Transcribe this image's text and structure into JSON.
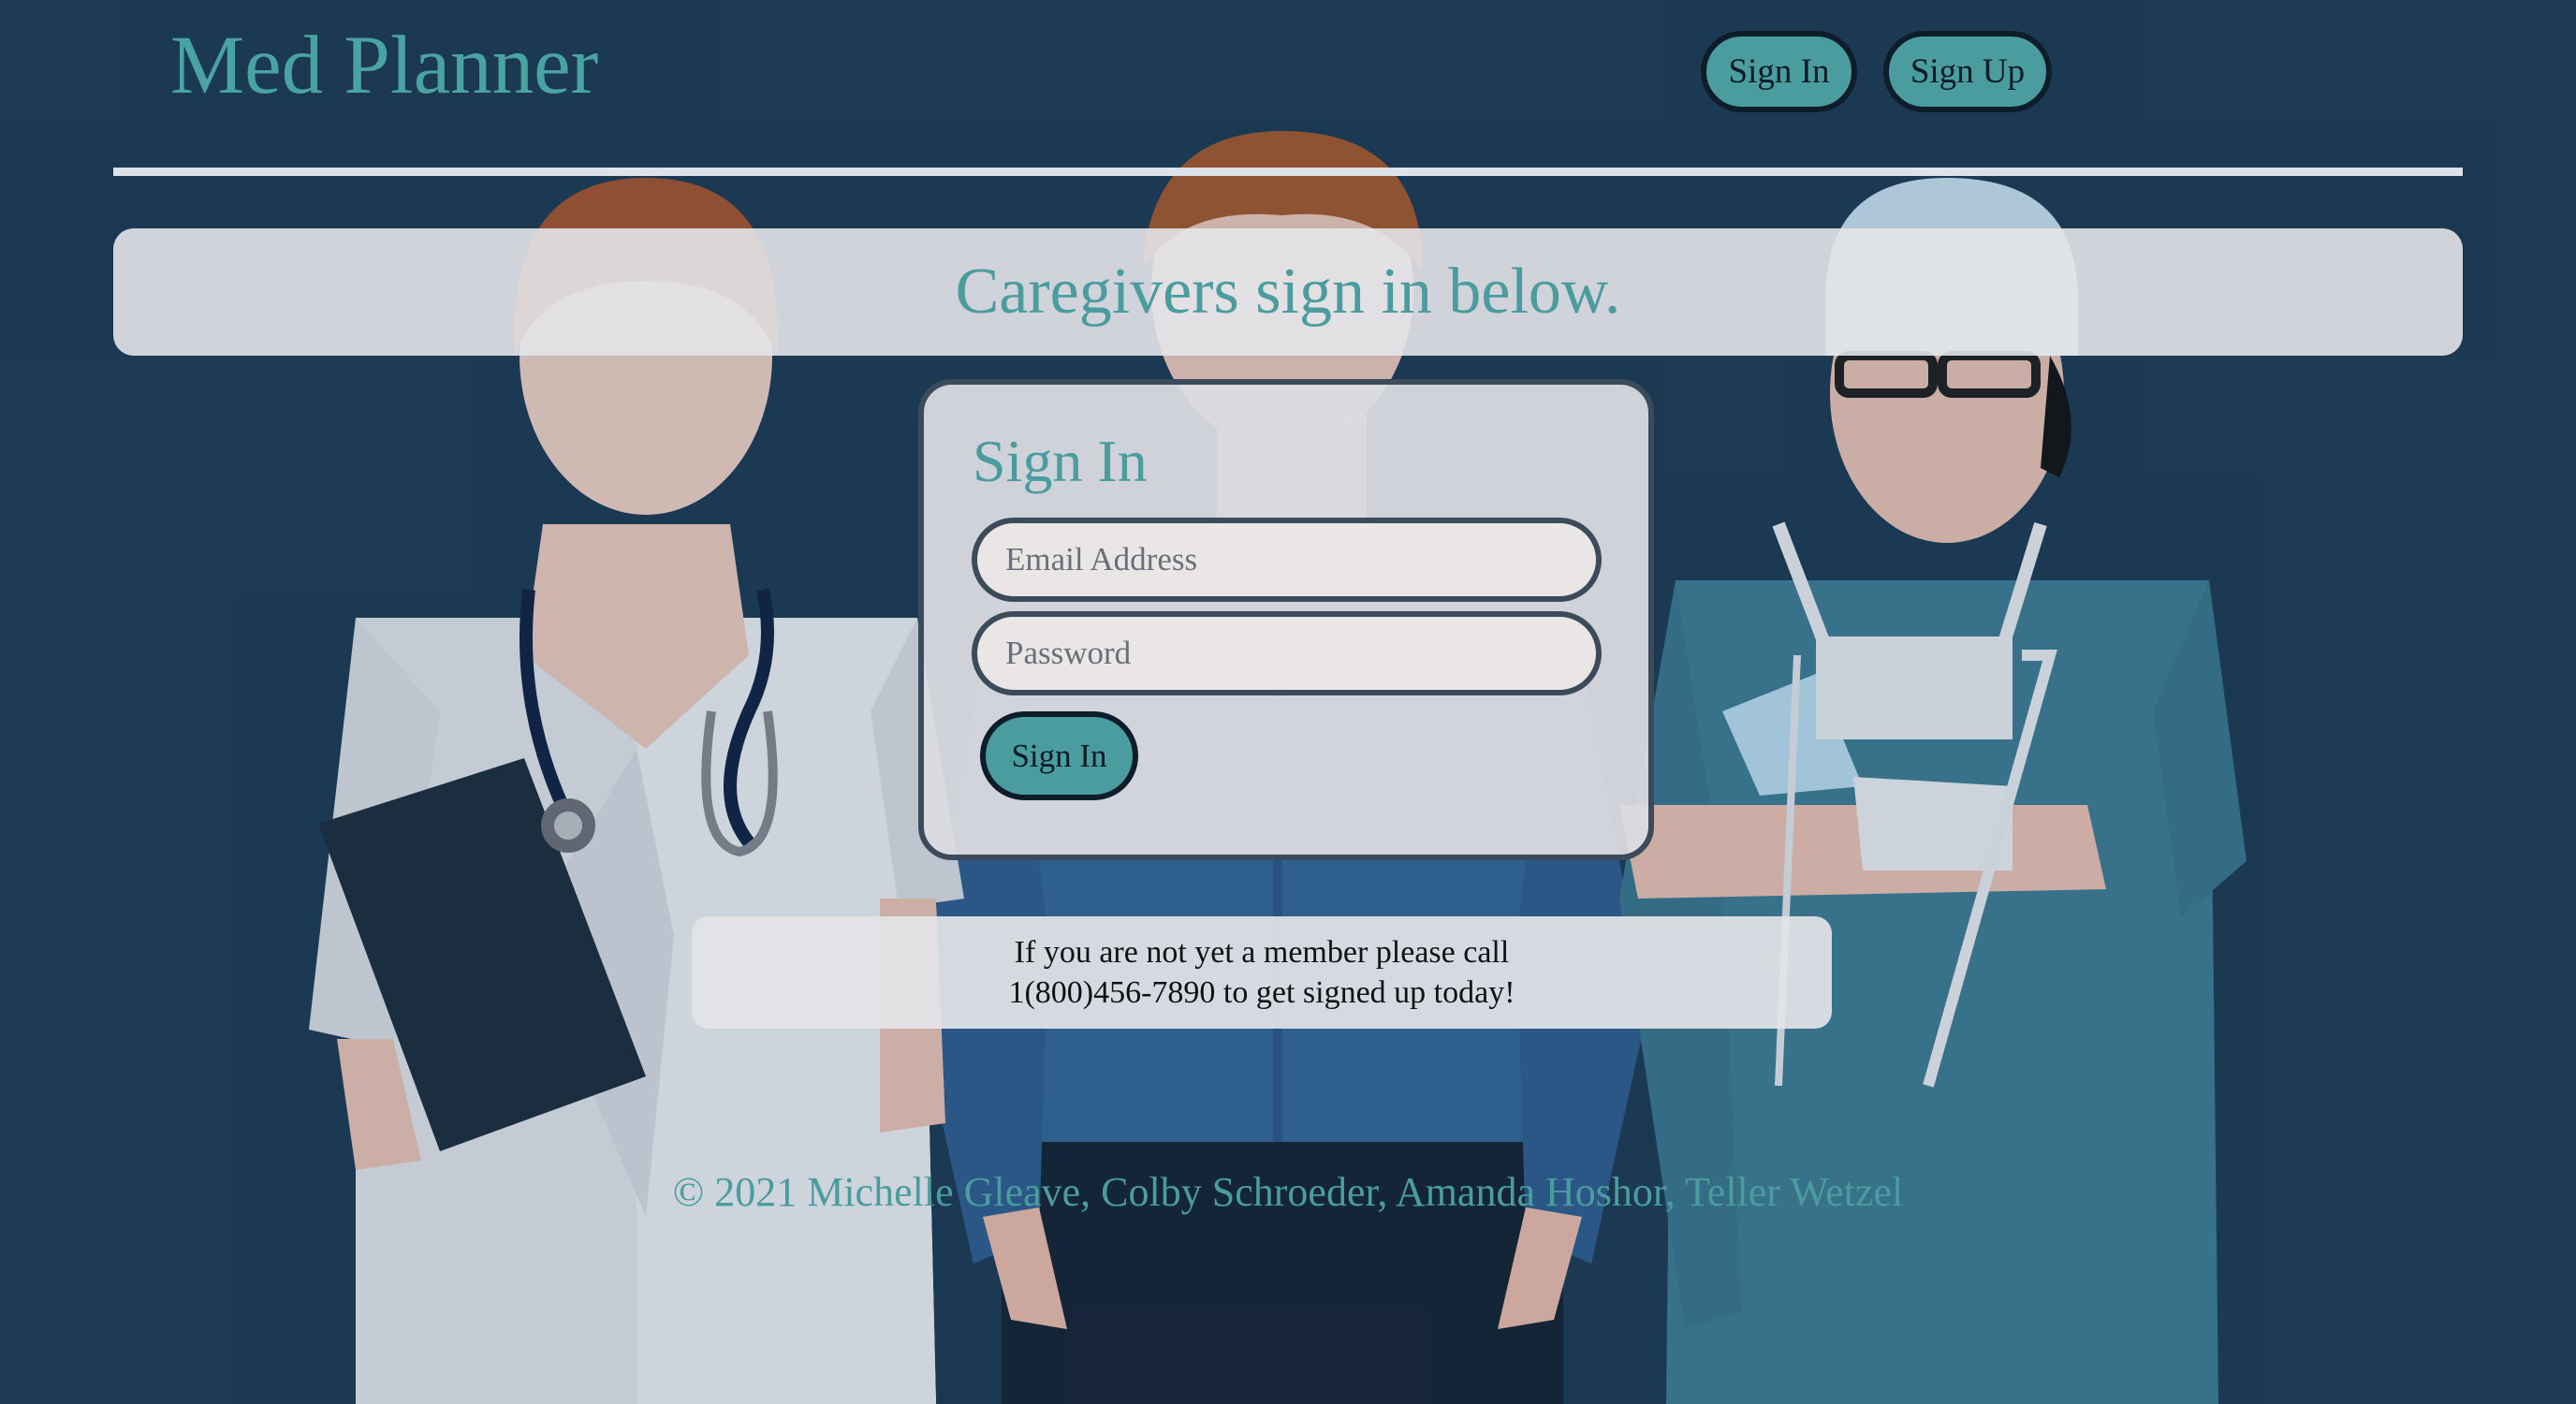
{
  "header": {
    "brand": "Med Planner",
    "nav": {
      "signin_label": "Sign In",
      "signup_label": "Sign Up"
    }
  },
  "banner": {
    "text": "Caregivers sign in below."
  },
  "signin_form": {
    "title": "Sign In",
    "email_placeholder": "Email Address",
    "email_value": "",
    "password_placeholder": "Password",
    "password_value": "",
    "submit_label": "Sign In"
  },
  "notice": {
    "line1": "If you are not yet a member please call",
    "line2": "1(800)456-7890 to get signed up today!"
  },
  "footer": {
    "text": "© 2021 Michelle Gleave, Colby Schroeder, Amanda Hoshor, Teller Wetzel"
  },
  "colors": {
    "background": "#1d3a55",
    "accent": "#4a9c9f",
    "panel": "#e4e4e8",
    "border": "#3c4b59"
  },
  "icons": [
    "doctor-illustration",
    "patient-illustration",
    "surgeon-illustration",
    "stethoscope-icon",
    "clipboard-icon"
  ]
}
